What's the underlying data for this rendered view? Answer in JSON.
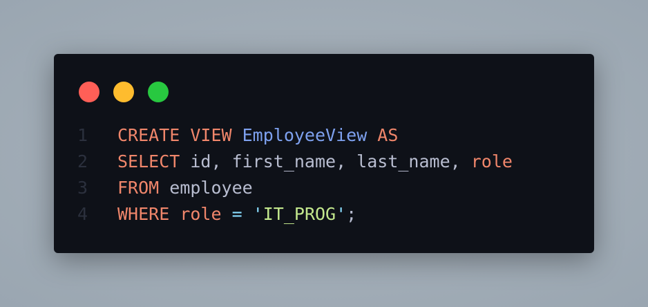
{
  "window": {
    "controls": [
      {
        "name": "close",
        "color": "#ff5f57"
      },
      {
        "name": "minimize",
        "color": "#febc2e"
      },
      {
        "name": "maximize",
        "color": "#28c840"
      }
    ]
  },
  "code": {
    "lines": [
      {
        "number": "1",
        "tokens": [
          {
            "text": "CREATE VIEW ",
            "type": "keyword"
          },
          {
            "text": "EmployeeView",
            "type": "identifier"
          },
          {
            "text": " AS",
            "type": "keyword"
          }
        ]
      },
      {
        "number": "2",
        "tokens": [
          {
            "text": "SELECT ",
            "type": "keyword"
          },
          {
            "text": "id, first_name, last_name, ",
            "type": "plain"
          },
          {
            "text": "role",
            "type": "keyword"
          }
        ]
      },
      {
        "number": "3",
        "tokens": [
          {
            "text": "FROM ",
            "type": "keyword"
          },
          {
            "text": "employee",
            "type": "plain"
          }
        ]
      },
      {
        "number": "4",
        "tokens": [
          {
            "text": "WHERE ",
            "type": "keyword"
          },
          {
            "text": "role ",
            "type": "keyword"
          },
          {
            "text": "= ",
            "type": "operator"
          },
          {
            "text": "'",
            "type": "operator"
          },
          {
            "text": "IT_PROG",
            "type": "string"
          },
          {
            "text": "'",
            "type": "operator"
          },
          {
            "text": ";",
            "type": "plain"
          }
        ]
      }
    ]
  }
}
